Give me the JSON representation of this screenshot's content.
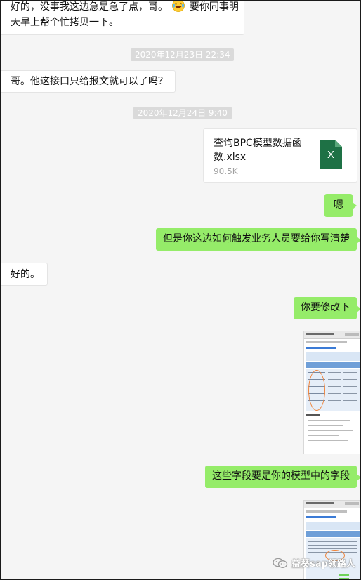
{
  "messages": {
    "m1_line1": "好的，没事我这边急是急了点，哥。",
    "m1_line2_suffix": "要你同事明",
    "m1_line3": "天早上帮个忙拷贝一下。",
    "ts1": "2020年12月23日 22:34",
    "m2": "哥。他这接口只给报文就可以了吗？",
    "ts2": "2020年12月24日 9:40",
    "file": {
      "name_line1": "查询BPC模型数据函",
      "name_line2": "数.xlsx",
      "size": "90.5K",
      "icon_letter": "X",
      "icon_color": "#1e7145"
    },
    "m3": "嗯",
    "m4": "但是你这边如何触发业务人员要给你写清楚",
    "m5": "好的。",
    "m6": "你要修改下",
    "m7": "这些字段要是你的模型中的字段"
  },
  "watermark": {
    "text": "益葵sap领路人",
    "icon": "wechat-icon"
  },
  "emoji": "laughing-tears-emoji",
  "colors": {
    "chat_bg": "#f5f5f5",
    "bubble_green": "#95ec69",
    "bubble_white": "#ffffff",
    "accent_green": "#6fd35a"
  }
}
